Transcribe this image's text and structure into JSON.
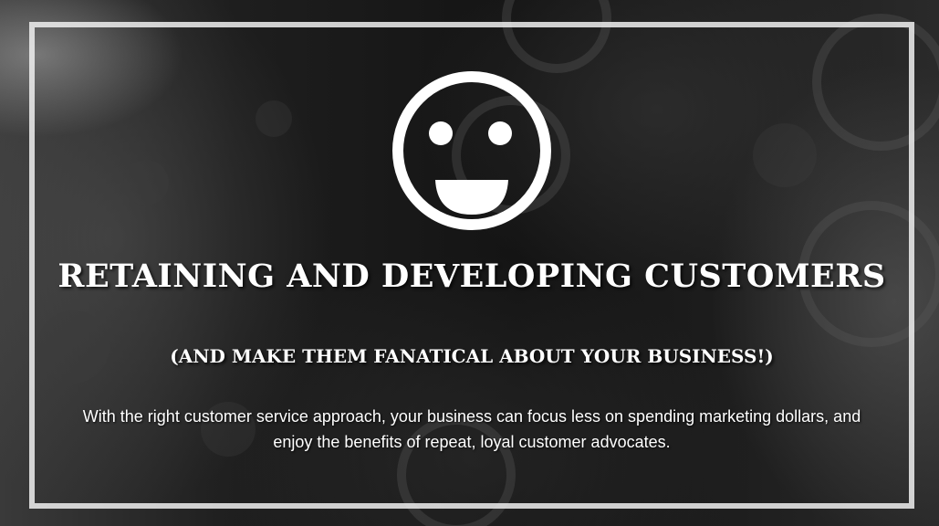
{
  "hero": {
    "icon": "smiley-face-icon",
    "title": "RETAINING AND DEVELOPING CUSTOMERS",
    "subtitle": "(AND MAKE THEM FANATICAL ABOUT YOUR BUSINESS!)",
    "body": "With the right customer service approach, your business can focus less on spending marketing dollars, and enjoy the benefits of repeat, loyal customer advocates."
  },
  "colors": {
    "text": "#ffffff",
    "frame": "#f0f0f0",
    "background": "#141414"
  }
}
